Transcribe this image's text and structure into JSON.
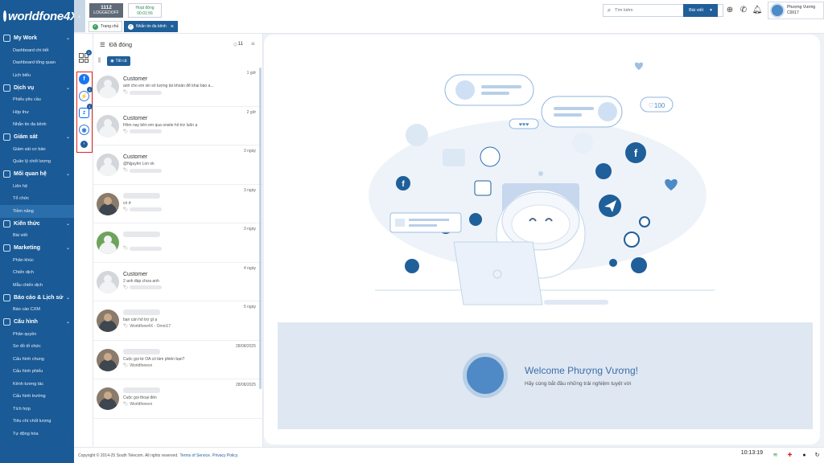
{
  "app": {
    "logo": "worldfone4X"
  },
  "sidebar": {
    "sections": [
      {
        "label": "My Work",
        "items": [
          "Dashboard chi tiết",
          "Dashboard tổng quan",
          "Lịch biểu"
        ]
      },
      {
        "label": "Dịch vụ",
        "items": [
          "Phiếu yêu cầu",
          "Hộp thư",
          "Nhắn tin đa kênh"
        ]
      },
      {
        "label": "Giám sát",
        "items": [
          "Giám sát cơ bản",
          "Quản lý chốt lượng"
        ]
      },
      {
        "label": "Mối quan hệ",
        "items": [
          "Liên hệ",
          "Tổ chức",
          "Tiềm năng"
        ]
      },
      {
        "label": "Kiến thức",
        "items": [
          "Bài viết"
        ]
      },
      {
        "label": "Marketing",
        "items": [
          "Phân khúc",
          "Chiến dịch",
          "Mẫu chiến dịch"
        ]
      },
      {
        "label": "Báo cáo & Lịch sử",
        "items": [
          "Báo cáo CXM"
        ]
      },
      {
        "label": "Cấu hình",
        "items": [
          "Phân quyền",
          "Sơ đồ tổ chức",
          "Cấu hình chung",
          "Cấu hình phiếu",
          "Kênh tương tác",
          "Cấu hình trường",
          "Tích hợp",
          "Tiêu chí chốt lượng",
          "Tự động hóa"
        ]
      }
    ]
  },
  "topbar": {
    "extension": "1112",
    "extension_status": "LOGGEDOFF",
    "activity_label": "Hoạt động",
    "activity_time": "00:01:56",
    "tabs": [
      {
        "label": "Trang chủ"
      },
      {
        "label": "Nhắn tin đa kênh"
      }
    ],
    "search_placeholder": "Tìm kiếm",
    "search_scope": "Bài viết",
    "user_name": "Phượng Vương",
    "user_id": "C0017"
  },
  "channels": {
    "grid_badge": "2",
    "messenger_badge": "1",
    "zalo_badge": "1"
  },
  "conversations": {
    "filter_label": "Đã đóng",
    "count": "11",
    "all_label": "Tất cả",
    "items": [
      {
        "name": "Customer",
        "message": "anh cho em xin số lượng tài khoản để khai báo a...",
        "time": "1 giờ",
        "avatar": "default"
      },
      {
        "name": "Customer",
        "message": "Hôm nay bên em qua onsite hỗ trợ luôn ạ",
        "time": "2 giờ",
        "avatar": "default"
      },
      {
        "name": "Customer",
        "message": "@Nguyễn Lon ok",
        "time": "3 ngày",
        "avatar": "default"
      },
      {
        "name": "",
        "message": "có ở",
        "time": "3 ngày",
        "avatar": "photo"
      },
      {
        "name": "",
        "message": "",
        "time": "3 ngày",
        "avatar": "green"
      },
      {
        "name": "Customer",
        "message": "2 anh đáp chưa anh",
        "time": "4 ngày",
        "avatar": "default"
      },
      {
        "name": "",
        "message": "bạn cần hỗ trợ gì ạ",
        "sub": "Worldfone4X - Omni17",
        "time": "5 ngày",
        "avatar": "photo"
      },
      {
        "name": "",
        "message": "Cuộc gọi từ OA có làm phiền bạn?",
        "sub": "Worldfonevn",
        "time": "28/08/2025",
        "avatar": "photo"
      },
      {
        "name": "",
        "message": "Cuộc gọi thoại đến",
        "sub": "Worldfonevn",
        "time": "28/08/2025",
        "avatar": "photo"
      }
    ]
  },
  "welcome": {
    "title": "Welcome Phượng Vương!",
    "subtitle": "Hãy cùng bắt đầu những trải nghiệm tuyệt vời"
  },
  "footer": {
    "copyright": "Copyright © 2014-25 South Telecom. All rights reserved.",
    "terms": "Terms of Service",
    "privacy": "Privacy Policy",
    "clock": "10:13:19"
  },
  "colors": {
    "primary": "#1f5f9a",
    "sidebar": "#1a5a96",
    "accent": "#2e7bd6"
  }
}
